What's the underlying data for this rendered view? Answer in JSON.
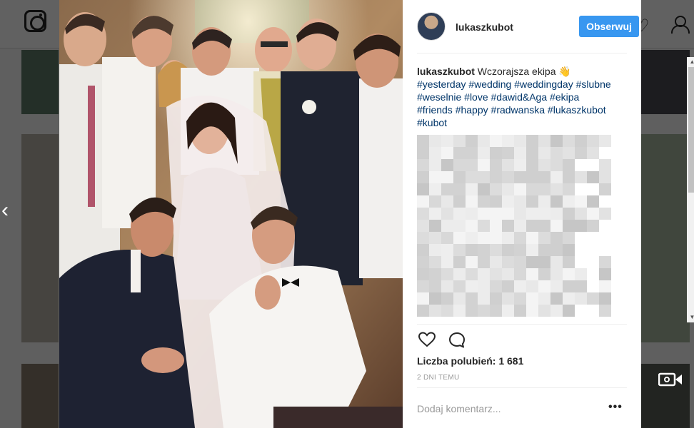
{
  "post": {
    "username": "lukaszkubot",
    "follow_label": "Obserwuj",
    "caption_user": "lukaszkubot",
    "caption_text": "Wczorajsza ekipa 👋",
    "hashtags": [
      "#yesterday",
      "#wedding",
      "#weddingday",
      "#slubne",
      "#weselnie",
      "#love",
      "#dawid&Aga",
      "#ekipa",
      "#friends",
      "#happy",
      "#radwanska",
      "#lukaszkubot",
      "#kubot"
    ],
    "likes_text": "Liczba polubień: 1 681",
    "time_text": "2 DNI TEMU",
    "comment_placeholder": "Dodaj komentarz...",
    "more_label": "•••"
  },
  "icons": {
    "logo": "instagram-logo",
    "prev": "chevron-left-icon",
    "like": "heart-outline-icon",
    "comment": "comment-bubble-icon",
    "activity": "heart-icon",
    "profile": "user-icon",
    "video": "video-camera-icon"
  },
  "colors": {
    "accent": "#3897f0",
    "hashtag": "#003569",
    "text": "#262626",
    "muted": "#999999"
  }
}
